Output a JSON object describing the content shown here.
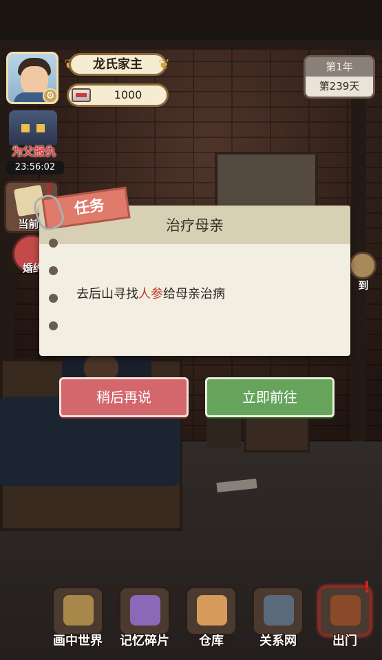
{
  "hud": {
    "player_title": "龙氏家主",
    "money": "1000",
    "calendar": {
      "year": "第1年",
      "day": "第239天"
    }
  },
  "events": {
    "revenge": {
      "title": "为父报仇",
      "timer": "23:56:02"
    },
    "current_task_label": "当前任",
    "marriage_label": "婚约",
    "checkin_label": "到"
  },
  "task_dialog": {
    "tag": "任务",
    "title": "治疗母亲",
    "description_before": "去后山寻找",
    "description_highlight": "人参",
    "description_after": "给母亲治病",
    "later_button": "稍后再说",
    "go_now_button": "立即前往"
  },
  "bottom_nav": {
    "items": [
      {
        "label": "画中世界",
        "icon": "chained-painting-icon"
      },
      {
        "label": "记忆碎片",
        "icon": "puzzle-brain-icon"
      },
      {
        "label": "仓库",
        "icon": "warehouse-icon"
      },
      {
        "label": "关系网",
        "icon": "people-icon"
      },
      {
        "label": "出门",
        "icon": "door-icon"
      }
    ]
  },
  "colors": {
    "later_button": "#d4676c",
    "go_now_button": "#66a45c",
    "highlight_text": "#c0392b",
    "event_title": "#e23a3a"
  }
}
